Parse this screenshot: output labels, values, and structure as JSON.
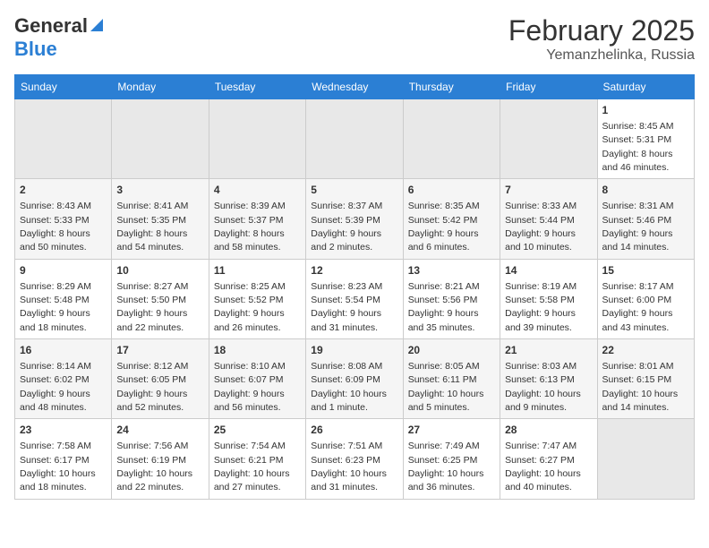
{
  "header": {
    "logo_general": "General",
    "logo_blue": "Blue",
    "month_year": "February 2025",
    "location": "Yemanzhelinka, Russia"
  },
  "weekdays": [
    "Sunday",
    "Monday",
    "Tuesday",
    "Wednesday",
    "Thursday",
    "Friday",
    "Saturday"
  ],
  "weeks": [
    [
      {
        "day": "",
        "info": ""
      },
      {
        "day": "",
        "info": ""
      },
      {
        "day": "",
        "info": ""
      },
      {
        "day": "",
        "info": ""
      },
      {
        "day": "",
        "info": ""
      },
      {
        "day": "",
        "info": ""
      },
      {
        "day": "1",
        "info": "Sunrise: 8:45 AM\nSunset: 5:31 PM\nDaylight: 8 hours\nand 46 minutes."
      }
    ],
    [
      {
        "day": "2",
        "info": "Sunrise: 8:43 AM\nSunset: 5:33 PM\nDaylight: 8 hours\nand 50 minutes."
      },
      {
        "day": "3",
        "info": "Sunrise: 8:41 AM\nSunset: 5:35 PM\nDaylight: 8 hours\nand 54 minutes."
      },
      {
        "day": "4",
        "info": "Sunrise: 8:39 AM\nSunset: 5:37 PM\nDaylight: 8 hours\nand 58 minutes."
      },
      {
        "day": "5",
        "info": "Sunrise: 8:37 AM\nSunset: 5:39 PM\nDaylight: 9 hours\nand 2 minutes."
      },
      {
        "day": "6",
        "info": "Sunrise: 8:35 AM\nSunset: 5:42 PM\nDaylight: 9 hours\nand 6 minutes."
      },
      {
        "day": "7",
        "info": "Sunrise: 8:33 AM\nSunset: 5:44 PM\nDaylight: 9 hours\nand 10 minutes."
      },
      {
        "day": "8",
        "info": "Sunrise: 8:31 AM\nSunset: 5:46 PM\nDaylight: 9 hours\nand 14 minutes."
      }
    ],
    [
      {
        "day": "9",
        "info": "Sunrise: 8:29 AM\nSunset: 5:48 PM\nDaylight: 9 hours\nand 18 minutes."
      },
      {
        "day": "10",
        "info": "Sunrise: 8:27 AM\nSunset: 5:50 PM\nDaylight: 9 hours\nand 22 minutes."
      },
      {
        "day": "11",
        "info": "Sunrise: 8:25 AM\nSunset: 5:52 PM\nDaylight: 9 hours\nand 26 minutes."
      },
      {
        "day": "12",
        "info": "Sunrise: 8:23 AM\nSunset: 5:54 PM\nDaylight: 9 hours\nand 31 minutes."
      },
      {
        "day": "13",
        "info": "Sunrise: 8:21 AM\nSunset: 5:56 PM\nDaylight: 9 hours\nand 35 minutes."
      },
      {
        "day": "14",
        "info": "Sunrise: 8:19 AM\nSunset: 5:58 PM\nDaylight: 9 hours\nand 39 minutes."
      },
      {
        "day": "15",
        "info": "Sunrise: 8:17 AM\nSunset: 6:00 PM\nDaylight: 9 hours\nand 43 minutes."
      }
    ],
    [
      {
        "day": "16",
        "info": "Sunrise: 8:14 AM\nSunset: 6:02 PM\nDaylight: 9 hours\nand 48 minutes."
      },
      {
        "day": "17",
        "info": "Sunrise: 8:12 AM\nSunset: 6:05 PM\nDaylight: 9 hours\nand 52 minutes."
      },
      {
        "day": "18",
        "info": "Sunrise: 8:10 AM\nSunset: 6:07 PM\nDaylight: 9 hours\nand 56 minutes."
      },
      {
        "day": "19",
        "info": "Sunrise: 8:08 AM\nSunset: 6:09 PM\nDaylight: 10 hours\nand 1 minute."
      },
      {
        "day": "20",
        "info": "Sunrise: 8:05 AM\nSunset: 6:11 PM\nDaylight: 10 hours\nand 5 minutes."
      },
      {
        "day": "21",
        "info": "Sunrise: 8:03 AM\nSunset: 6:13 PM\nDaylight: 10 hours\nand 9 minutes."
      },
      {
        "day": "22",
        "info": "Sunrise: 8:01 AM\nSunset: 6:15 PM\nDaylight: 10 hours\nand 14 minutes."
      }
    ],
    [
      {
        "day": "23",
        "info": "Sunrise: 7:58 AM\nSunset: 6:17 PM\nDaylight: 10 hours\nand 18 minutes."
      },
      {
        "day": "24",
        "info": "Sunrise: 7:56 AM\nSunset: 6:19 PM\nDaylight: 10 hours\nand 22 minutes."
      },
      {
        "day": "25",
        "info": "Sunrise: 7:54 AM\nSunset: 6:21 PM\nDaylight: 10 hours\nand 27 minutes."
      },
      {
        "day": "26",
        "info": "Sunrise: 7:51 AM\nSunset: 6:23 PM\nDaylight: 10 hours\nand 31 minutes."
      },
      {
        "day": "27",
        "info": "Sunrise: 7:49 AM\nSunset: 6:25 PM\nDaylight: 10 hours\nand 36 minutes."
      },
      {
        "day": "28",
        "info": "Sunrise: 7:47 AM\nSunset: 6:27 PM\nDaylight: 10 hours\nand 40 minutes."
      },
      {
        "day": "",
        "info": ""
      }
    ]
  ]
}
